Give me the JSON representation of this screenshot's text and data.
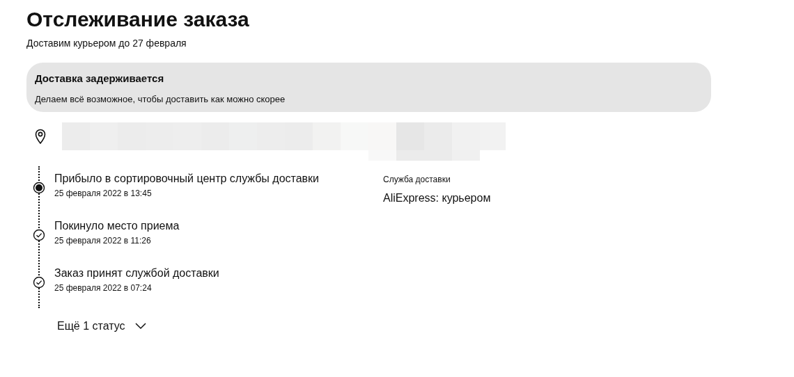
{
  "title": "Отслеживание заказа",
  "subtitle": "Доставим курьером до 27 февраля",
  "alert": {
    "title": "Доставка задерживается",
    "text": "Делаем всё возможное, чтобы доставить как можно скорее"
  },
  "statuses": [
    {
      "kind": "current",
      "title": "Прибыло в сортировочный центр службы доставки",
      "date": "25 февраля 2022 в 13:45"
    },
    {
      "kind": "done",
      "title": "Покинуло место приема",
      "date": "25 февраля 2022 в 11:26"
    },
    {
      "kind": "done",
      "title": "Заказ принят службой доставки",
      "date": "25 февраля 2022 в 07:24"
    }
  ],
  "carrier": {
    "label": "Служба доставки",
    "value": "AliExpress: курьером"
  },
  "more_button": {
    "label": "Ещё 1 статус"
  }
}
